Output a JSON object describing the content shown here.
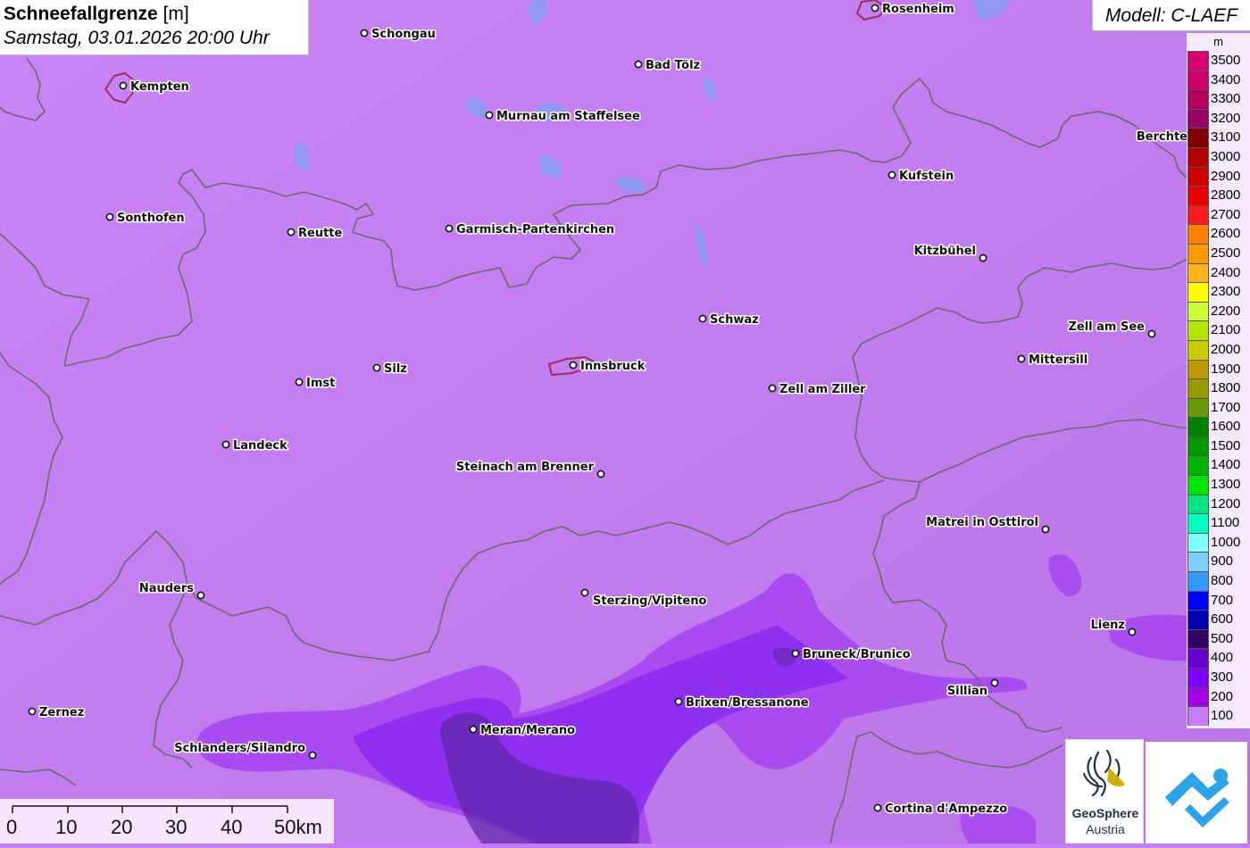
{
  "title": {
    "main": "Schneefallgrenze",
    "unit": "[m]",
    "datetime": "Samstag, 03.01.2026 20:00 Uhr"
  },
  "model": "Modell: C-LAEF",
  "legend": {
    "unit": "m",
    "items": [
      {
        "value": "3500",
        "color": "#d9006e"
      },
      {
        "value": "3400",
        "color": "#cc0066"
      },
      {
        "value": "3300",
        "color": "#b3005c"
      },
      {
        "value": "3200",
        "color": "#990066"
      },
      {
        "value": "3100",
        "color": "#800000"
      },
      {
        "value": "3000",
        "color": "#b30000"
      },
      {
        "value": "2900",
        "color": "#cc0000"
      },
      {
        "value": "2800",
        "color": "#e60000"
      },
      {
        "value": "2700",
        "color": "#ff1a1a"
      },
      {
        "value": "2600",
        "color": "#ff8000"
      },
      {
        "value": "2500",
        "color": "#ff9900"
      },
      {
        "value": "2400",
        "color": "#ffb31a"
      },
      {
        "value": "2300",
        "color": "#ffff00"
      },
      {
        "value": "2200",
        "color": "#ccff33"
      },
      {
        "value": "2100",
        "color": "#b3e600"
      },
      {
        "value": "2000",
        "color": "#cccc00"
      },
      {
        "value": "1900",
        "color": "#bf9900"
      },
      {
        "value": "1800",
        "color": "#999900"
      },
      {
        "value": "1700",
        "color": "#669900"
      },
      {
        "value": "1600",
        "color": "#008000"
      },
      {
        "value": "1500",
        "color": "#009900"
      },
      {
        "value": "1400",
        "color": "#00b300"
      },
      {
        "value": "1300",
        "color": "#00e600"
      },
      {
        "value": "1200",
        "color": "#00e680"
      },
      {
        "value": "1100",
        "color": "#00ffbf"
      },
      {
        "value": "1000",
        "color": "#80ffff"
      },
      {
        "value": "900",
        "color": "#80ccff"
      },
      {
        "value": "800",
        "color": "#3399ff"
      },
      {
        "value": "700",
        "color": "#0000ff"
      },
      {
        "value": "600",
        "color": "#0000b3"
      },
      {
        "value": "500",
        "color": "#330066"
      },
      {
        "value": "400",
        "color": "#6600cc"
      },
      {
        "value": "300",
        "color": "#8000ff"
      },
      {
        "value": "200",
        "color": "#a300e6"
      },
      {
        "value": "100",
        "color": "#c67cf6"
      }
    ]
  },
  "cities": [
    {
      "name": "Rosenheim"
    },
    {
      "name": "Schongau"
    },
    {
      "name": "Kempten"
    },
    {
      "name": "Bad Tölz"
    },
    {
      "name": "Murnau am Staffelsee"
    },
    {
      "name": "Berchte"
    },
    {
      "name": "Kufstein"
    },
    {
      "name": "Sonthofen"
    },
    {
      "name": "Reutte"
    },
    {
      "name": "Garmisch-Partenkirchen"
    },
    {
      "name": "Kitzbühel"
    },
    {
      "name": "Schwaz"
    },
    {
      "name": "Zell am See"
    },
    {
      "name": "Innsbruck"
    },
    {
      "name": "Silz"
    },
    {
      "name": "Mittersill"
    },
    {
      "name": "Imst"
    },
    {
      "name": "Zell am Ziller"
    },
    {
      "name": "Landeck"
    },
    {
      "name": "Steinach am Brenner"
    },
    {
      "name": "Matrei in Osttirol"
    },
    {
      "name": "Nauders"
    },
    {
      "name": "Sterzing/Vipiteno"
    },
    {
      "name": "Lienz"
    },
    {
      "name": "Bruneck/Brunico"
    },
    {
      "name": "Sillian"
    },
    {
      "name": "Brixen/Bressanone"
    },
    {
      "name": "Zernez"
    },
    {
      "name": "Meran/Merano"
    },
    {
      "name": "Schlanders/Silandro"
    },
    {
      "name": "Cortina d'Ampezzo"
    }
  ],
  "scalebar": {
    "labels": [
      "0",
      "10",
      "20",
      "30",
      "50km"
    ],
    "label_40": "40"
  },
  "logos": {
    "geosphere_line1": "GeoSphere",
    "geosphere_line2": "Austria"
  },
  "colors": {
    "background": "#c67cf6",
    "border": "#6b6b6b"
  }
}
